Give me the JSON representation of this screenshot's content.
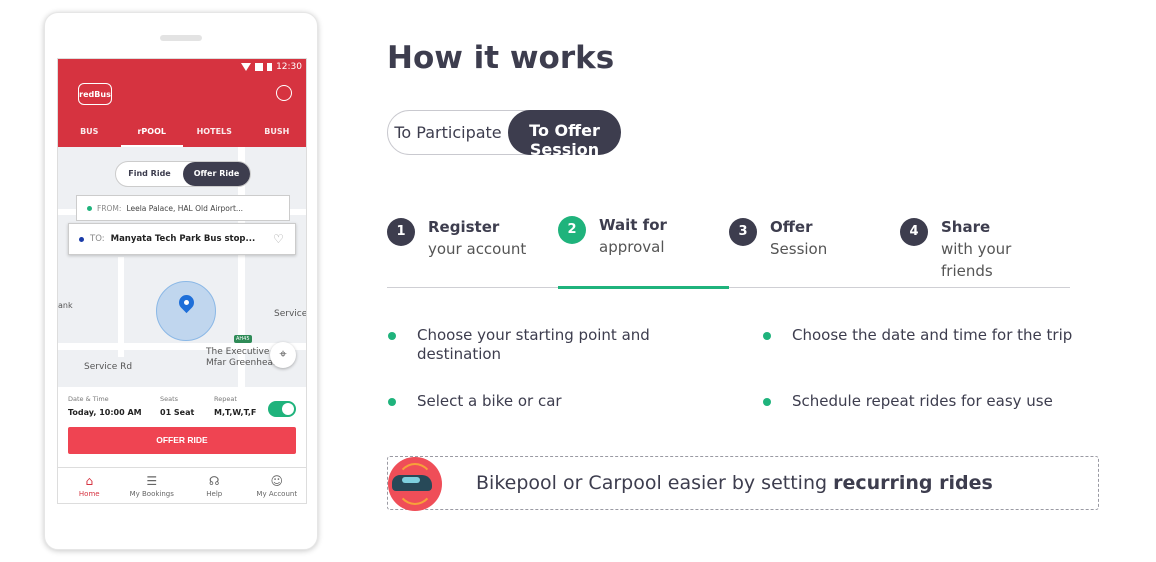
{
  "phone": {
    "status_time": "12:30",
    "brand": "redBus",
    "tabs": [
      "BUS",
      "rPOOL",
      "HOTELS",
      "BUSH"
    ],
    "toggle": {
      "find": "Find Ride",
      "offer": "Offer Ride"
    },
    "from": {
      "label": "FROM:",
      "value": "Leela Palace, HAL Old Airport..."
    },
    "to": {
      "label": "TO:",
      "value": "Manyata Tech Park Bus stop..."
    },
    "map_labels": {
      "bank": "ank",
      "service": "Service",
      "exec": "The Executive C",
      "mfar": "Mfar Greenheart",
      "service_rd": "Service Rd",
      "hw": "AH45"
    },
    "trip": {
      "date_label": "Date & Time",
      "date_value": "Today, 10:00 AM",
      "seats_label": "Seats",
      "seats_value": "01 Seat",
      "repeat_label": "Repeat",
      "repeat_value": "M,T,W,T,F"
    },
    "offer_button": "OFFER RIDE",
    "nav": [
      "Home",
      "My Bookings",
      "Help",
      "My Account"
    ]
  },
  "main": {
    "title": "How it works",
    "segment": {
      "participate": "To Participate",
      "offer": "To Offer Session"
    },
    "steps": [
      {
        "num": "1",
        "head": "Register",
        "rest": "your account"
      },
      {
        "num": "2",
        "head": "Wait for",
        "rest": "approval"
      },
      {
        "num": "3",
        "head": "Offer",
        "rest": "Session"
      },
      {
        "num": "4",
        "head": "Share",
        "rest": "with your friends"
      }
    ],
    "features": [
      "Choose your starting point and",
      "destination",
      "Choose the date and time for the trip",
      "Select a bike or car",
      "Schedule repeat rides for easy use"
    ],
    "banner": {
      "text": "Bikepool or Carpool easier by setting ",
      "bold": "recurring rides"
    }
  },
  "colors": {
    "accent_green": "#1fb37c",
    "brand_red": "#d63340",
    "dark": "#3d3d4e"
  }
}
